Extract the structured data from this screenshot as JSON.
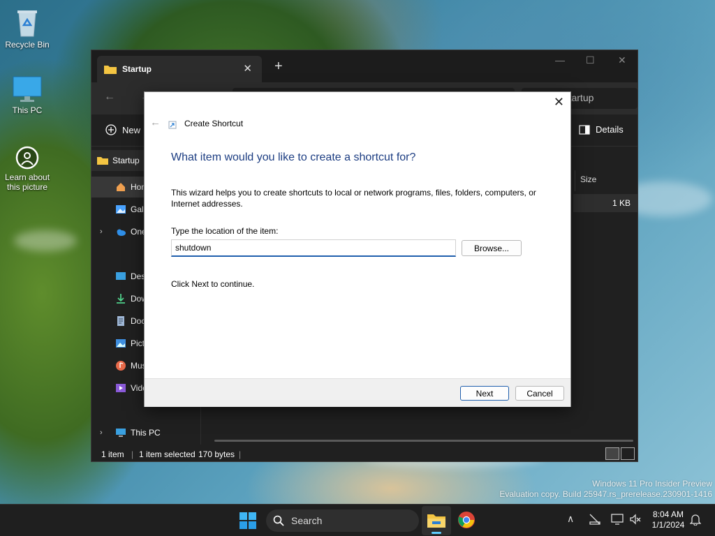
{
  "desktop": {
    "icons": [
      {
        "label": "Recycle Bin",
        "icon": "recycle-bin-icon"
      },
      {
        "label": "This PC",
        "icon": "monitor-icon"
      },
      {
        "label": "Learn about this picture",
        "icon": "info-camera-icon"
      }
    ]
  },
  "explorer": {
    "tab_title": "Startup",
    "address_text": "Start Menu  >  Programs  >  Startup",
    "search_placeholder": "Search Startup",
    "new_label": "New",
    "details_label": "Details",
    "nav": {
      "pinned": "Startup",
      "items": [
        "Home",
        "Gallery",
        "OneDrive",
        "Desktop",
        "Downloads",
        "Documents",
        "Pictures",
        "Music",
        "Videos"
      ],
      "this_pc": "This PC"
    },
    "column_size": "Size",
    "file_size": "1 KB",
    "status": {
      "count": "1 item",
      "selected": "1 item selected",
      "bytes": "170 bytes"
    }
  },
  "wizard": {
    "title": "Create Shortcut",
    "heading": "What item would you like to create a shortcut for?",
    "description": "This wizard helps you to create shortcuts to local or network programs, files, folders, computers, or Internet addresses.",
    "location_label": "Type the location of the item:",
    "location_value": "shutdown",
    "browse_label": "Browse...",
    "hint": "Click Next to continue.",
    "next_label": "Next",
    "cancel_label": "Cancel"
  },
  "watermark": {
    "line1": "Windows 11 Pro Insider Preview",
    "line2": "Evaluation copy. Build 25947.rs_prerelease.230901-1416"
  },
  "taskbar": {
    "search_label": "Search",
    "time": "8:04 AM",
    "date": "1/1/2024"
  },
  "colors": {
    "accent": "#1f5fad",
    "heading": "#1c3d82",
    "explorer_bg": "#202020",
    "taskbar_bg": "#1f1f1f"
  }
}
